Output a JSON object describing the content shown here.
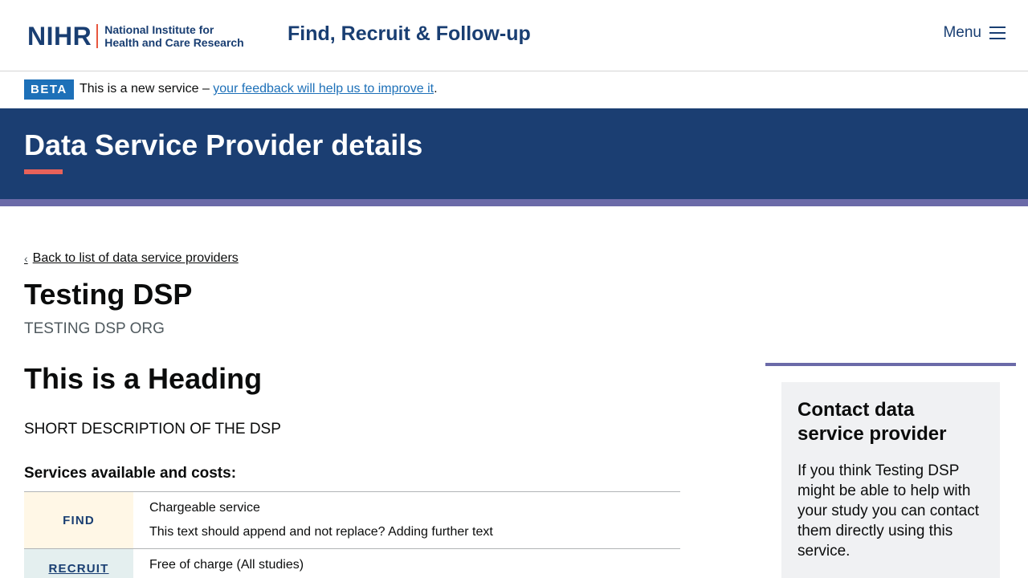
{
  "header": {
    "logo_mark": "NIHR",
    "logo_text_line1": "National Institute for",
    "logo_text_line2": "Health and Care Research",
    "service_name": "Find, Recruit & Follow-up",
    "menu_label": "Menu"
  },
  "beta": {
    "tag": "BETA",
    "text_before": "This is a new service – ",
    "link_text": "your feedback will help us to improve it",
    "text_after": "."
  },
  "banner": {
    "title": "Data Service Provider details"
  },
  "main": {
    "back_link": "Back to list of data service providers",
    "dsp_name": "Testing DSP",
    "dsp_org": "TESTING DSP ORG",
    "heading": "This is a Heading",
    "short_description": "SHORT DESCRIPTION OF THE DSP",
    "services_label": "Services available and costs:",
    "services": [
      {
        "tag": "FIND",
        "cost": "Chargeable service",
        "note": "This text should append and not replace? Adding further text"
      },
      {
        "tag": "RECRUIT",
        "cost": "Free of charge (All studies)"
      }
    ]
  },
  "sidebar": {
    "contact_title": "Contact data service provider",
    "contact_text": "If you think Testing DSP might be able to help with your study you can contact them directly using this service."
  },
  "colors": {
    "brand_navy": "#1b3e72",
    "accent_red": "#e8625a",
    "stripe_purple": "#6b6aa8",
    "link_blue": "#1d70b8"
  }
}
